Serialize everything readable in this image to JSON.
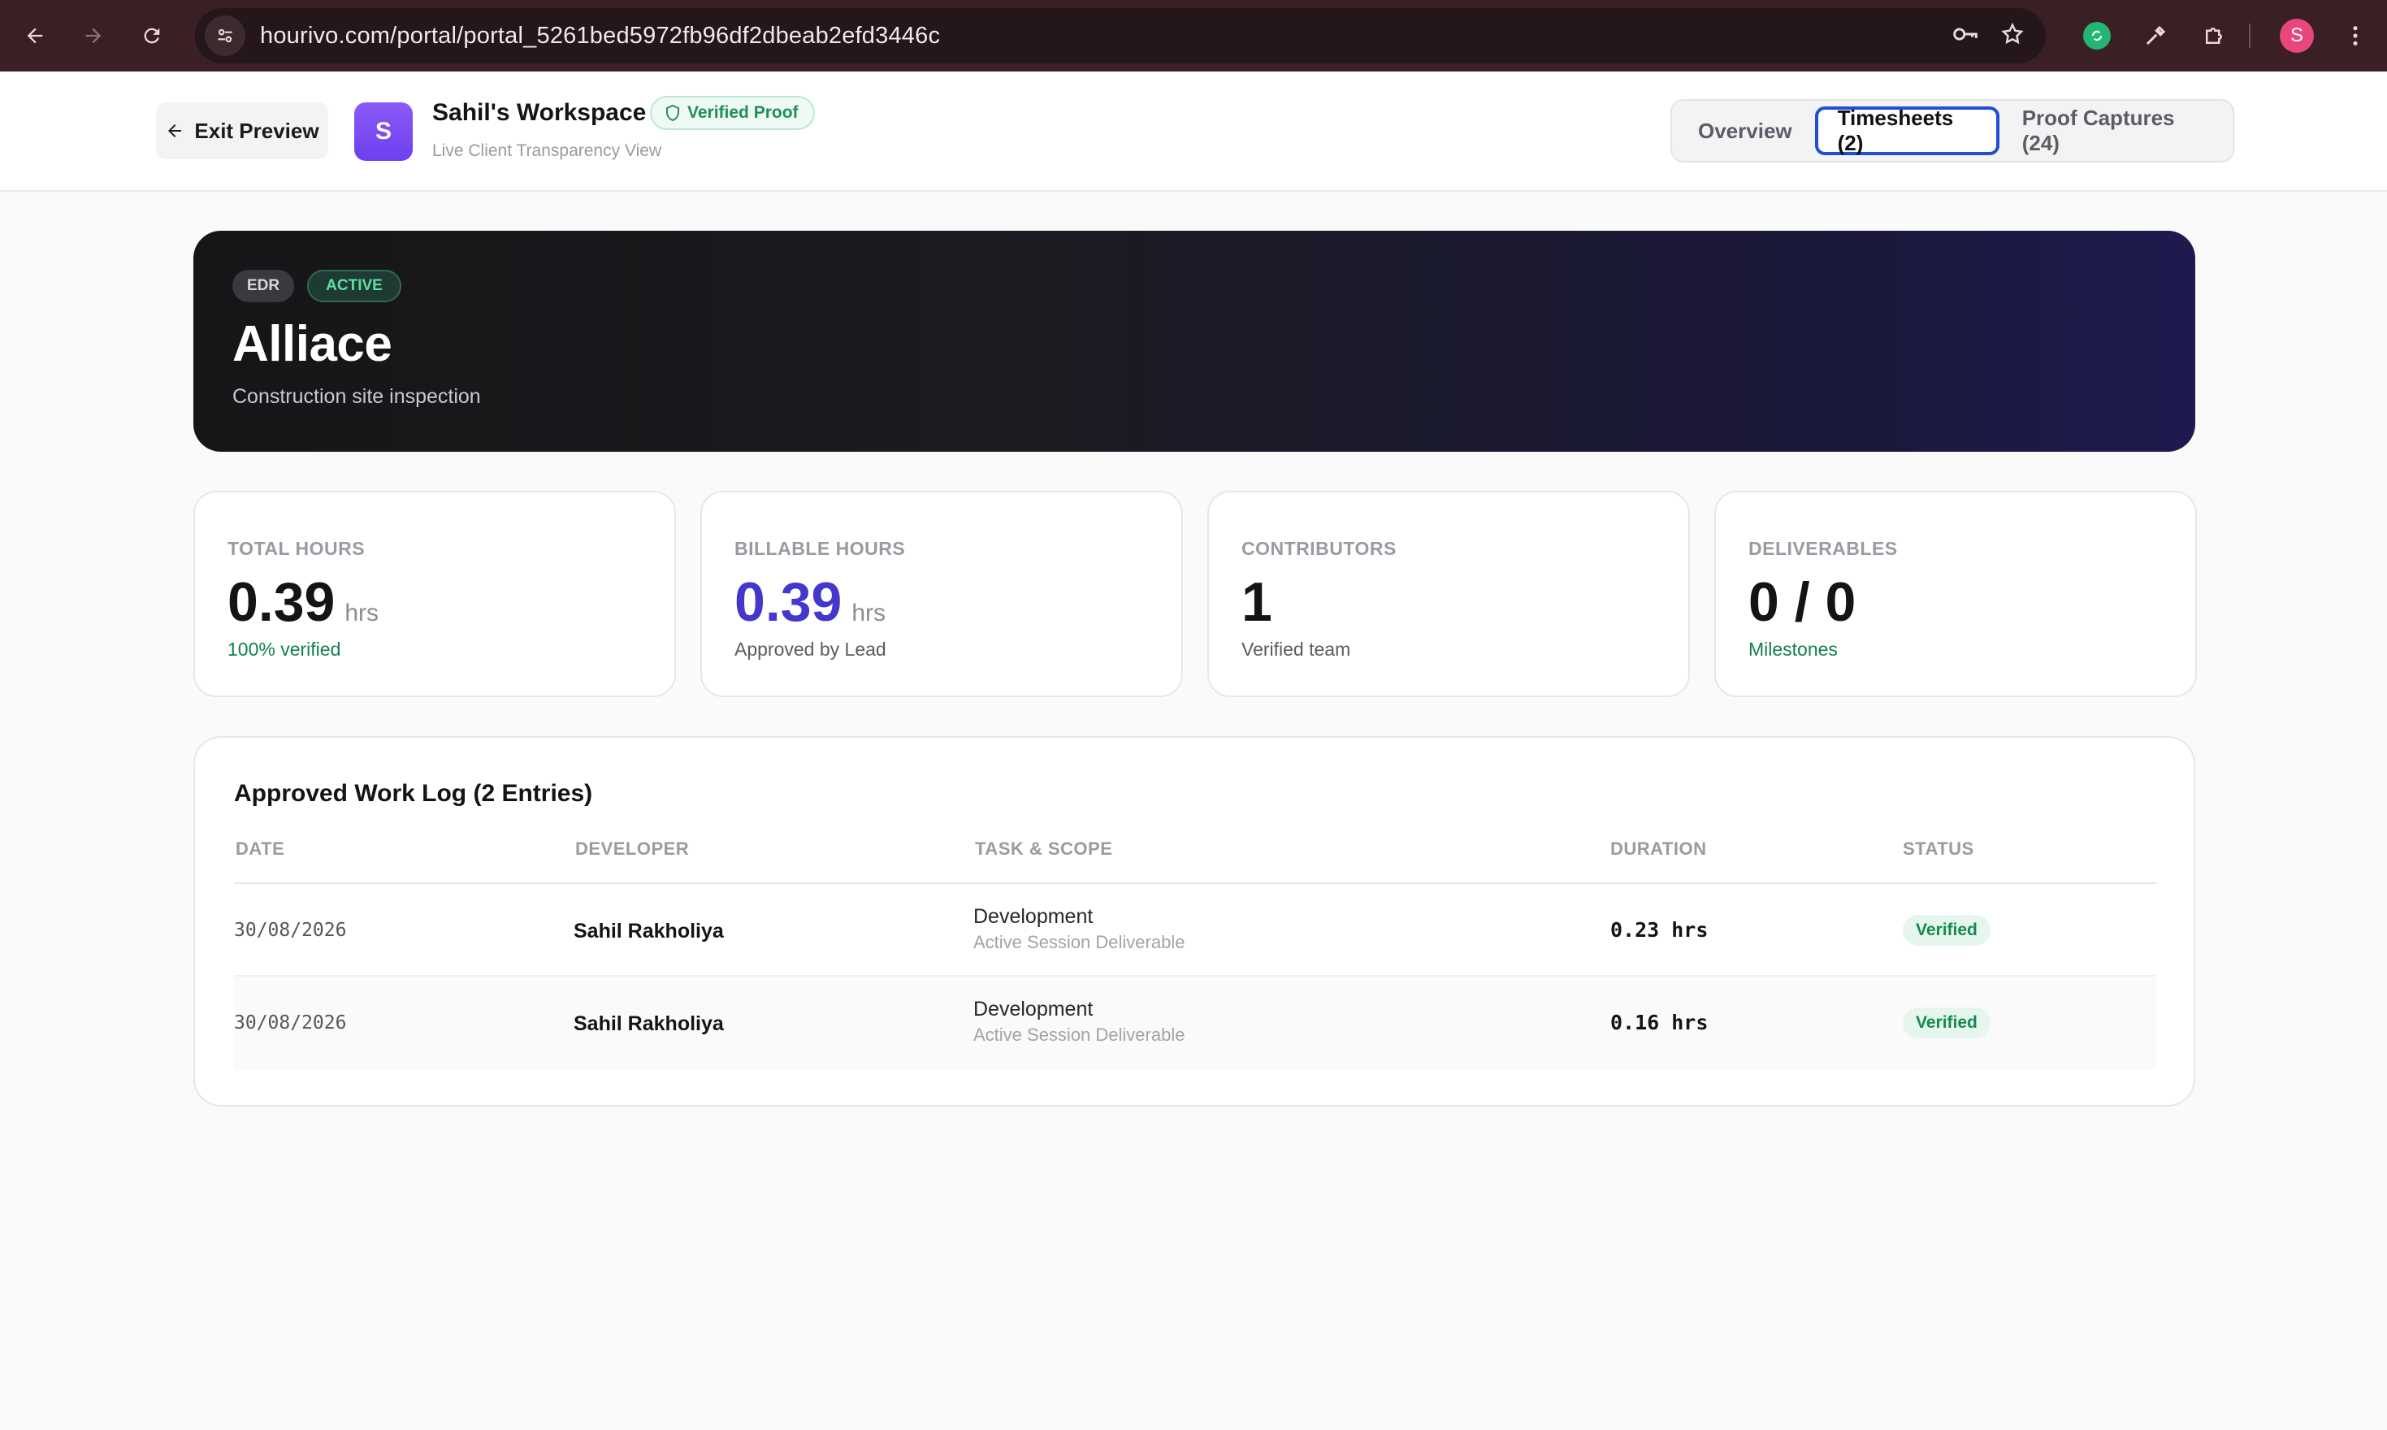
{
  "browser": {
    "url": "hourivo.com/portal/portal_5261bed5972fb96df2dbeab2efd3446c",
    "profile_initial": "S"
  },
  "header": {
    "exit_label": "Exit Preview",
    "avatar_initial": "S",
    "workspace_name": "Sahil's Workspace",
    "verified_label": "Verified Proof",
    "subtitle": "Live Client Transparency View",
    "tabs": [
      {
        "label": "Overview",
        "active": false
      },
      {
        "label": "Timesheets (2)",
        "active": true
      },
      {
        "label": "Proof Captures (24)",
        "active": false
      }
    ]
  },
  "project": {
    "code": "EDR",
    "status": "ACTIVE",
    "name": "Alliace",
    "description": "Construction site inspection"
  },
  "stats": [
    {
      "label": "TOTAL HOURS",
      "value": "0.39",
      "unit": "hrs",
      "note": "100% verified"
    },
    {
      "label": "BILLABLE HOURS",
      "value": "0.39",
      "unit": "hrs",
      "note": "Approved by Lead"
    },
    {
      "label": "CONTRIBUTORS",
      "value": "1",
      "unit": "",
      "note": "Verified team"
    },
    {
      "label": "DELIVERABLES",
      "value": "0 / 0",
      "unit": "",
      "note": "Milestones"
    }
  ],
  "worklog": {
    "title": "Approved Work Log (2 Entries)",
    "columns": [
      "DATE",
      "DEVELOPER",
      "TASK & SCOPE",
      "DURATION",
      "STATUS"
    ],
    "rows": [
      {
        "date": "30/08/2026",
        "developer": "Sahil Rakholiya",
        "task": "Development",
        "scope": "Active Session Deliverable",
        "duration": "0.23 hrs",
        "status": "Verified"
      },
      {
        "date": "30/08/2026",
        "developer": "Sahil Rakholiya",
        "task": "Development",
        "scope": "Active Session Deliverable",
        "duration": "0.16 hrs",
        "status": "Verified"
      }
    ]
  },
  "colors": {
    "accent_blue": "#1e4fd6",
    "billable_blue": "#4338ca",
    "verified_green": "#12804d",
    "avatar_purple": "#7c4cf3"
  }
}
